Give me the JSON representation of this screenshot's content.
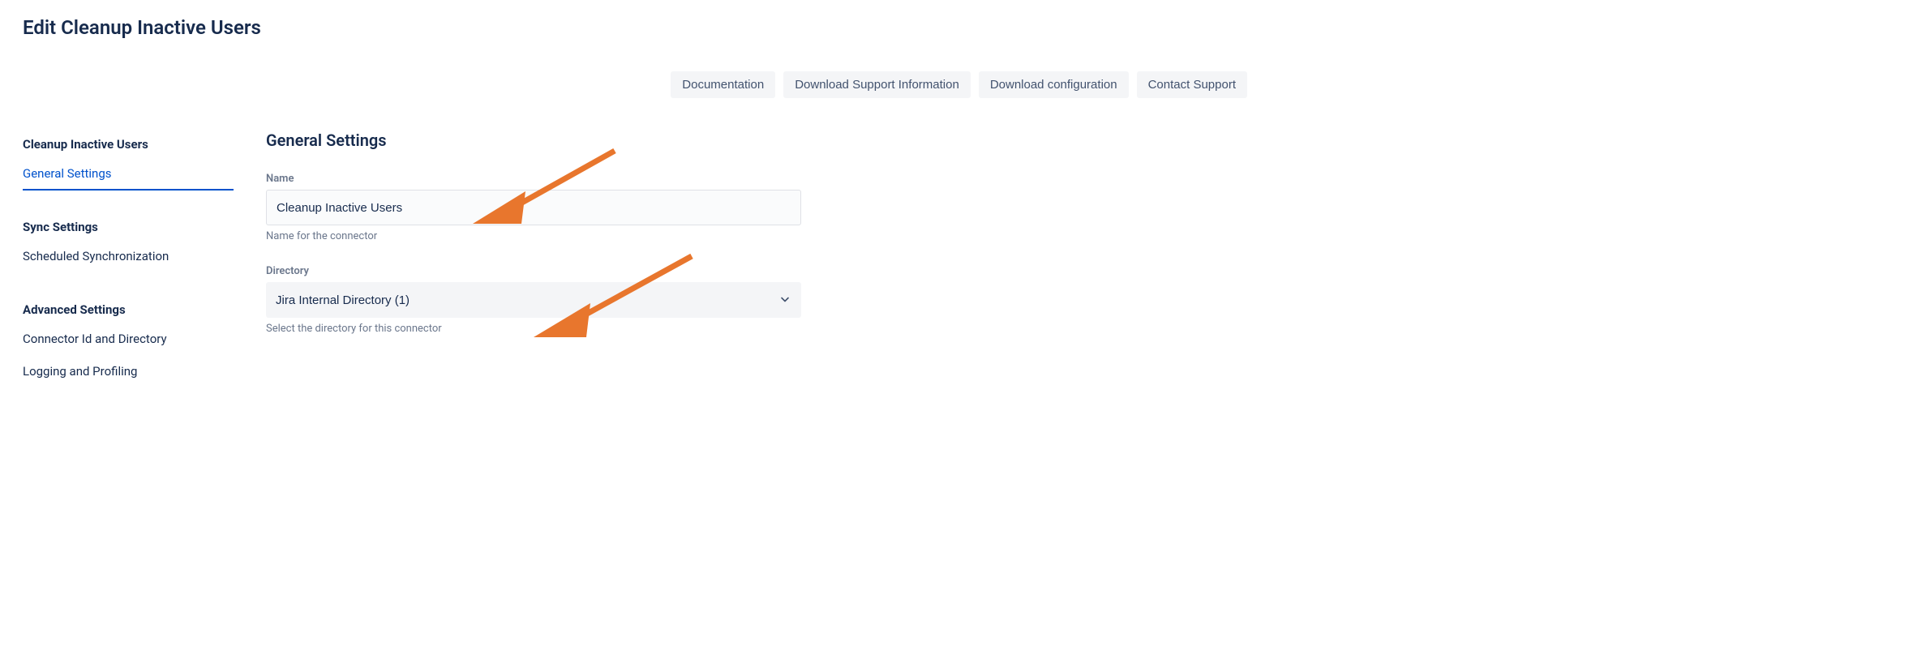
{
  "page_title": "Edit Cleanup Inactive Users",
  "actions": {
    "documentation": "Documentation",
    "download_support": "Download Support Information",
    "download_config": "Download configuration",
    "contact_support": "Contact Support"
  },
  "sidebar": {
    "group1": {
      "heading": "Cleanup Inactive Users",
      "items": [
        "General Settings"
      ]
    },
    "group2": {
      "heading": "Sync Settings",
      "items": [
        "Scheduled Synchronization"
      ]
    },
    "group3": {
      "heading": "Advanced Settings",
      "items": [
        "Connector Id and Directory",
        "Logging and Profiling"
      ]
    }
  },
  "main": {
    "section_title": "General Settings",
    "name_field": {
      "label": "Name",
      "value": "Cleanup Inactive Users",
      "help": "Name for the connector"
    },
    "directory_field": {
      "label": "Directory",
      "selected": "Jira Internal Directory (1)",
      "help": "Select the directory for this connector"
    }
  }
}
